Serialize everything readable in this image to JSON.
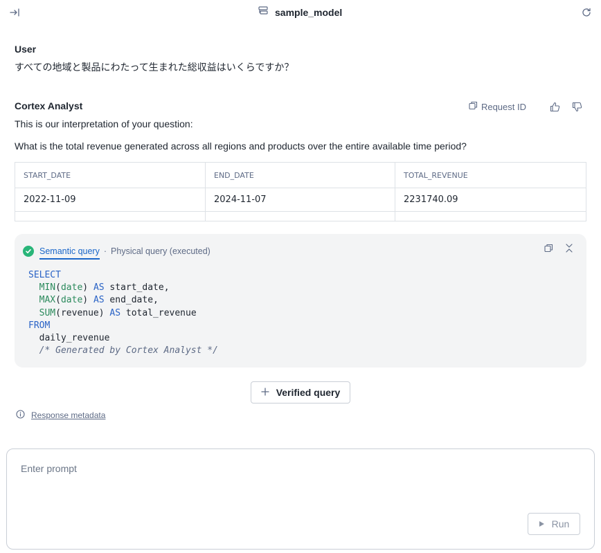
{
  "header": {
    "model_name": "sample_model"
  },
  "user_message": {
    "author": "User",
    "text": "すべての地域と製品にわたって生まれた総収益はいくらですか？"
  },
  "analyst_message": {
    "author": "Cortex Analyst",
    "request_id_label": "Request ID",
    "interpretation_intro": "This is our interpretation of your question:",
    "interpretation": "What is the total revenue generated across all regions and products over the entire available time period?"
  },
  "result_table": {
    "columns": [
      "START_DATE",
      "END_DATE",
      "TOTAL_REVENUE"
    ],
    "rows": [
      [
        "2022-11-09",
        "2024-11-07",
        "2231740.09"
      ]
    ]
  },
  "query_panel": {
    "tab_semantic": "Semantic query",
    "separator": "·",
    "tab_physical": "Physical query (executed)",
    "code": {
      "select": "SELECT",
      "min_fn": "MIN",
      "max_fn": "MAX",
      "sum_fn": "SUM",
      "date_col": "date",
      "revenue_col": "revenue",
      "as_kw": "AS",
      "start_alias": "start_date,",
      "end_alias": "end_date,",
      "total_alias": "total_revenue",
      "from": "FROM",
      "table": "daily_revenue",
      "comment": "/* Generated by Cortex Analyst */"
    }
  },
  "verified_query_label": "Verified query",
  "response_metadata_label": "Response metadata",
  "prompt": {
    "placeholder": "Enter prompt",
    "value": "",
    "run_label": "Run"
  },
  "colors": {
    "accent": "#1a66c9",
    "success": "#29b579",
    "keyword": "#2a63c6",
    "function": "#2b8a5c",
    "panel_bg": "#f3f4f5"
  },
  "icons": {
    "collapse": "collapse-panel-icon",
    "model": "semantic-model-icon",
    "refresh": "refresh-icon",
    "copy": "copy-icon",
    "thumbs_up": "thumbs-up-icon",
    "thumbs_down": "thumbs-down-icon",
    "check": "check-circle-icon",
    "collapse_section": "collapse-section-icon",
    "plus": "plus-icon",
    "info": "info-icon",
    "play": "play-icon"
  }
}
